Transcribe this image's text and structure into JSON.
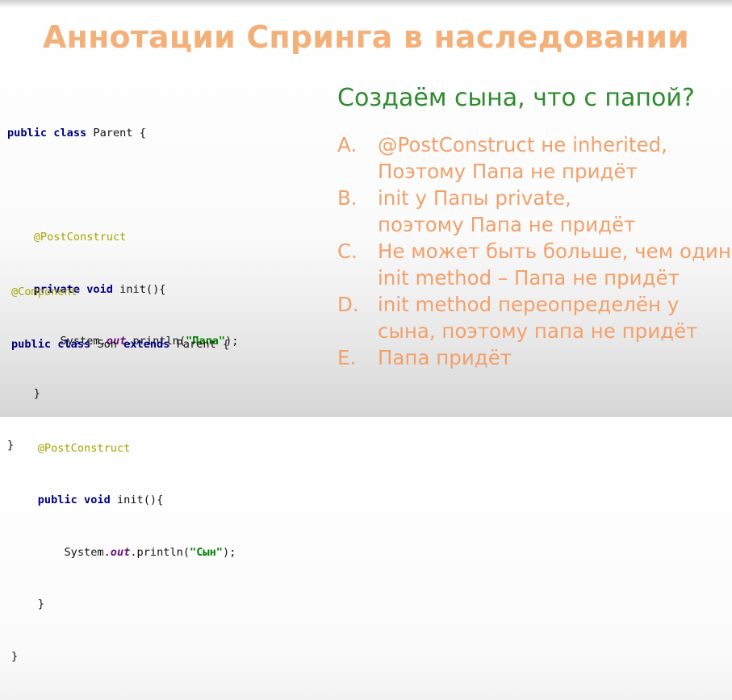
{
  "slide": {
    "title": "Аннотации Спринга в наследовании",
    "question": "Создаём сына, что с папой?",
    "code_parent": {
      "l1_kw1": "public",
      "l1_kw2": "class",
      "l1_rest": " Parent {",
      "annotation": "@PostConstruct",
      "l3_kw1": "private",
      "l3_kw2": "void",
      "l3_rest": " init(){",
      "l4_pre": "System.",
      "l4_field": "out",
      "l4_mid": ".println(",
      "l4_str": "\"Папа\"",
      "l4_post": ");",
      "close_inner": "}",
      "close_outer": "}"
    },
    "code_son": {
      "class_annotation": "@Component",
      "l1_kw1": "public",
      "l1_kw2": "class",
      "l1_mid": " Son ",
      "l1_kw3": "extends",
      "l1_rest": " Parent {",
      "annotation": "@PostConstruct",
      "l3_kw1": "public",
      "l3_kw2": "void",
      "l3_rest": " init(){",
      "l4_pre": "System.",
      "l4_field": "out",
      "l4_mid": ".println(",
      "l4_str": "\"Сын\"",
      "l4_post": ");",
      "close_inner": "}",
      "close_outer": "}"
    },
    "answers": [
      {
        "letter": "A.",
        "line1": "@PostConstruct не inherited,",
        "line2": "Поэтому Папа не придёт"
      },
      {
        "letter": "B.",
        "line1": "init у Папы private,",
        "line2": "поэтому Папа не придёт"
      },
      {
        "letter": "C.",
        "line1": "Не может быть больше, чем один",
        "line2": "init method – Папа не придёт"
      },
      {
        "letter": "D.",
        "line1": "init method переопределён у",
        "line2": "сына, поэтому папа не придёт"
      },
      {
        "letter": "E.",
        "line1": "Папа придёт",
        "line2": ""
      }
    ],
    "colors": {
      "title": "#f4b079",
      "question": "#2e8b2e",
      "answers": "#f2a06a"
    }
  }
}
